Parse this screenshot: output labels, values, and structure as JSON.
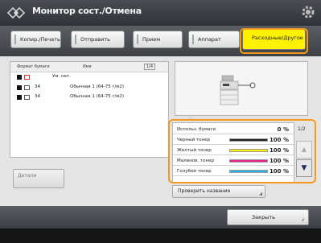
{
  "window": {
    "title": "Монитор сост./Отмена"
  },
  "tabs": [
    {
      "label": "Копир./Печать",
      "active": false
    },
    {
      "label": "Отправить",
      "active": false
    },
    {
      "label": "Прием",
      "active": false
    },
    {
      "label": "Аппарат",
      "active": false
    },
    {
      "label": "Расходные/Другое",
      "active": true
    }
  ],
  "jobs": {
    "header": {
      "format": "Формат бумаги",
      "name": "Имя",
      "pages": "1/4"
    },
    "rows": [
      {
        "num": "",
        "name": "Ум. нет."
      },
      {
        "num": "34",
        "name": "Обычная 1 (64-75 г/м2)"
      },
      {
        "num": "34",
        "name": "Обычная 1 (64-75 г/м2)"
      }
    ],
    "details_label": "Детали"
  },
  "supplies": {
    "rows": [
      {
        "label": "Использ. бумаги",
        "percent": "0 %",
        "color": ""
      },
      {
        "label": "Черный тонер",
        "percent": "100 %",
        "color": "#222222"
      },
      {
        "label": "Желтый тонер",
        "percent": "100 %",
        "color": "#ffee00"
      },
      {
        "label": "Малинов. тонер",
        "percent": "100 %",
        "color": "#e7258e"
      },
      {
        "label": "Голубой тонер",
        "percent": "100 %",
        "color": "#2ab3e6"
      }
    ],
    "page": "1/2",
    "check_label": "Проверить название"
  },
  "device": {
    "dots": "···"
  },
  "footer": {
    "close_label": "Закрыть"
  },
  "colors": {
    "highlight_outline": "#f29a1e",
    "active_tab": "#fff200"
  }
}
